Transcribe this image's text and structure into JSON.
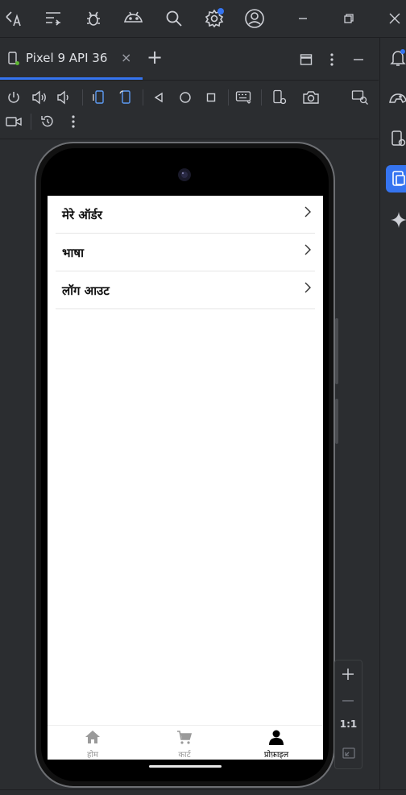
{
  "window": {
    "tab_label": "Pixel 9 API 36",
    "tab_close": "×",
    "new_tab": "+"
  },
  "zoom": {
    "reset_label": "1:1"
  },
  "app": {
    "menu": [
      {
        "label": "मेरे ऑर्डर"
      },
      {
        "label": "भाषा"
      },
      {
        "label": "लॉग आउट"
      }
    ],
    "nav": [
      {
        "label": "होम",
        "active": false
      },
      {
        "label": "कार्ट",
        "active": false
      },
      {
        "label": "प्रोफ़ाइल",
        "active": true
      }
    ]
  },
  "colors": {
    "accent": "#3574f0",
    "notification_dot": "#3574f0",
    "ide_background": "#2b2d30"
  }
}
